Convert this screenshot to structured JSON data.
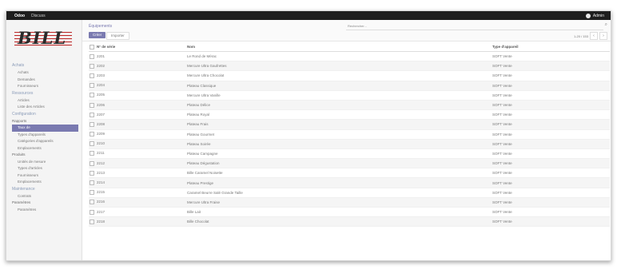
{
  "topbar": {
    "brand": "Odoo",
    "app": "Discuss",
    "user": "Admin"
  },
  "logo": {
    "text": "BILL"
  },
  "sidebar": {
    "sections": [
      {
        "type": "sec",
        "label": "Achats"
      },
      {
        "type": "item",
        "label": "Achats"
      },
      {
        "type": "item",
        "label": "Demandes"
      },
      {
        "type": "item",
        "label": "Fournisseurs"
      },
      {
        "type": "sec",
        "label": "Ressources"
      },
      {
        "type": "item",
        "label": "Articles"
      },
      {
        "type": "item",
        "label": "Liste des Articles"
      },
      {
        "type": "sec",
        "label": "Configuration"
      },
      {
        "type": "grp",
        "label": "Rapports"
      },
      {
        "type": "item",
        "label": "Taux de",
        "active": true
      },
      {
        "type": "item",
        "label": "Types d'appareils"
      },
      {
        "type": "item",
        "label": "Catégories d'appareils"
      },
      {
        "type": "item",
        "label": "Emplacements"
      },
      {
        "type": "grp",
        "label": "Produits"
      },
      {
        "type": "item",
        "label": "Unités de mesure"
      },
      {
        "type": "item",
        "label": "Types d'articles"
      },
      {
        "type": "item",
        "label": "Fournisseurs"
      },
      {
        "type": "item",
        "label": "Emplacements"
      },
      {
        "type": "sec",
        "label": "Maintenance"
      },
      {
        "type": "item",
        "label": "Contrats"
      },
      {
        "type": "grp",
        "label": "Paramètres"
      },
      {
        "type": "item",
        "label": "Paramètres"
      }
    ]
  },
  "main": {
    "breadcrumb": "Équipements",
    "search_placeholder": "Rechercher...",
    "create_label": "Créer",
    "import_label": "Importer",
    "pager_text": "1-20 / 153"
  },
  "table": {
    "headers": [
      "N° de série",
      "Nom",
      "Type d'appareil"
    ],
    "rows": [
      [
        "2201",
        "Le Rond de Mérac",
        "SOFT Vente"
      ],
      [
        "2202",
        "Mercure Ultra Gaufrettes",
        "SOFT Vente"
      ],
      [
        "2203",
        "Mercure Ultra Chocolat",
        "SOFT Vente"
      ],
      [
        "2204",
        "Plateau Classique",
        "SOFT Vente"
      ],
      [
        "2205",
        "Mercure Ultra Vanille",
        "SOFT Vente"
      ],
      [
        "2206",
        "Plateau Délice",
        "SOFT Vente"
      ],
      [
        "2207",
        "Plateau Royal",
        "SOFT Vente"
      ],
      [
        "2208",
        "Plateau Frais",
        "SOFT Vente"
      ],
      [
        "2209",
        "Plateau Gourmet",
        "SOFT Vente"
      ],
      [
        "2210",
        "Plateau Soirée",
        "SOFT Vente"
      ],
      [
        "2211",
        "Plateau Campagne",
        "SOFT Vente"
      ],
      [
        "2212",
        "Plateau Dégustation",
        "SOFT Vente"
      ],
      [
        "2213",
        "Bille Caramel Noisette",
        "SOFT Vente"
      ],
      [
        "2214",
        "Plateau Prestige",
        "SOFT Vente"
      ],
      [
        "2215",
        "Caramel Beurre Salé Grande Taille",
        "SOFT Vente"
      ],
      [
        "2216",
        "Mercure Ultra Fraise",
        "SOFT Vente"
      ],
      [
        "2217",
        "Bille Lait",
        "SOFT Vente"
      ],
      [
        "2218",
        "Bille Chocolat",
        "SOFT Vente"
      ]
    ]
  }
}
